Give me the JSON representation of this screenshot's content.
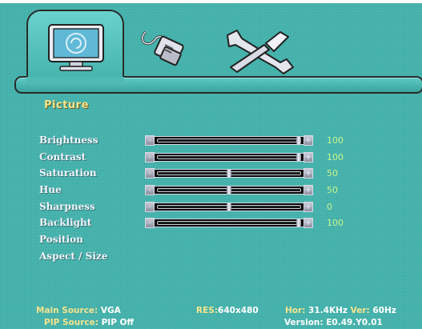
{
  "tabs": [
    {
      "name": "picture",
      "icon": "monitor-icon",
      "active": true
    },
    {
      "name": "connection",
      "icon": "plug-icon",
      "active": false
    },
    {
      "name": "tools",
      "icon": "tools-icon",
      "active": false
    }
  ],
  "section_title": "Picture",
  "menu": [
    {
      "label": "Brightness",
      "value": "100",
      "level": 100
    },
    {
      "label": "Contrast",
      "value": "100",
      "level": 100
    },
    {
      "label": "Saturation",
      "value": "50",
      "level": 50
    },
    {
      "label": "Hue",
      "value": "50",
      "level": 50
    },
    {
      "label": "Sharpness",
      "value": "0",
      "level": 50
    },
    {
      "label": "Backlight",
      "value": "100",
      "level": 100
    },
    {
      "label": "Position"
    },
    {
      "label": "Aspect / Size"
    }
  ],
  "slider_caps": {
    "minus": "-",
    "plus": "+"
  },
  "status": {
    "main_source_label": "Main Source:",
    "main_source_value": "VGA",
    "res_label": "RES:",
    "res_value": "640x480",
    "hor_label": "Hor:",
    "hor_value": "31.4KHz",
    "ver_label": "Ver:",
    "ver_value": "60Hz",
    "pip_source_label": "PIP Source:",
    "pip_source_value": "PIP Off",
    "version_value": "Version: E0.49.Y0.01"
  },
  "colors": {
    "background": "#46b3ad",
    "title": "#f4e48c",
    "value": "#c9f58a",
    "label": "#f2f4ff"
  }
}
